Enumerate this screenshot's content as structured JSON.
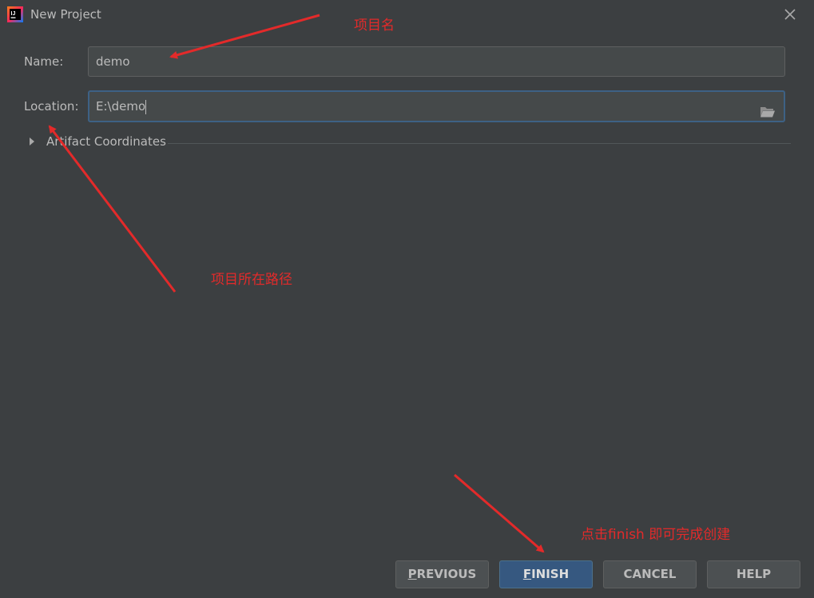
{
  "window": {
    "title": "New Project"
  },
  "form": {
    "name_label": "Name:",
    "name_value": "demo",
    "location_label": "Location:",
    "location_value": "E:\\demo"
  },
  "section": {
    "artifact_label": "Artifact Coordinates"
  },
  "buttons": {
    "previous_mnemonic": "P",
    "previous_rest": "REVIOUS",
    "finish_mnemonic": "F",
    "finish_rest": "INISH",
    "cancel": "CANCEL",
    "help": "HELP"
  },
  "annotations": {
    "project_name": "项目名",
    "project_path": "项目所在路径",
    "click_finish": "点击finish 即可完成创建"
  },
  "colors": {
    "background": "#3c3f41",
    "field_bg": "#45494a",
    "focus_border": "#3d6185",
    "default_button": "#365880",
    "annotation_red": "#e32a2a"
  },
  "icons": {
    "app": "intellij-idea-icon",
    "close": "close-icon",
    "folder": "folder-open-icon",
    "expand": "triangle-right-icon"
  }
}
